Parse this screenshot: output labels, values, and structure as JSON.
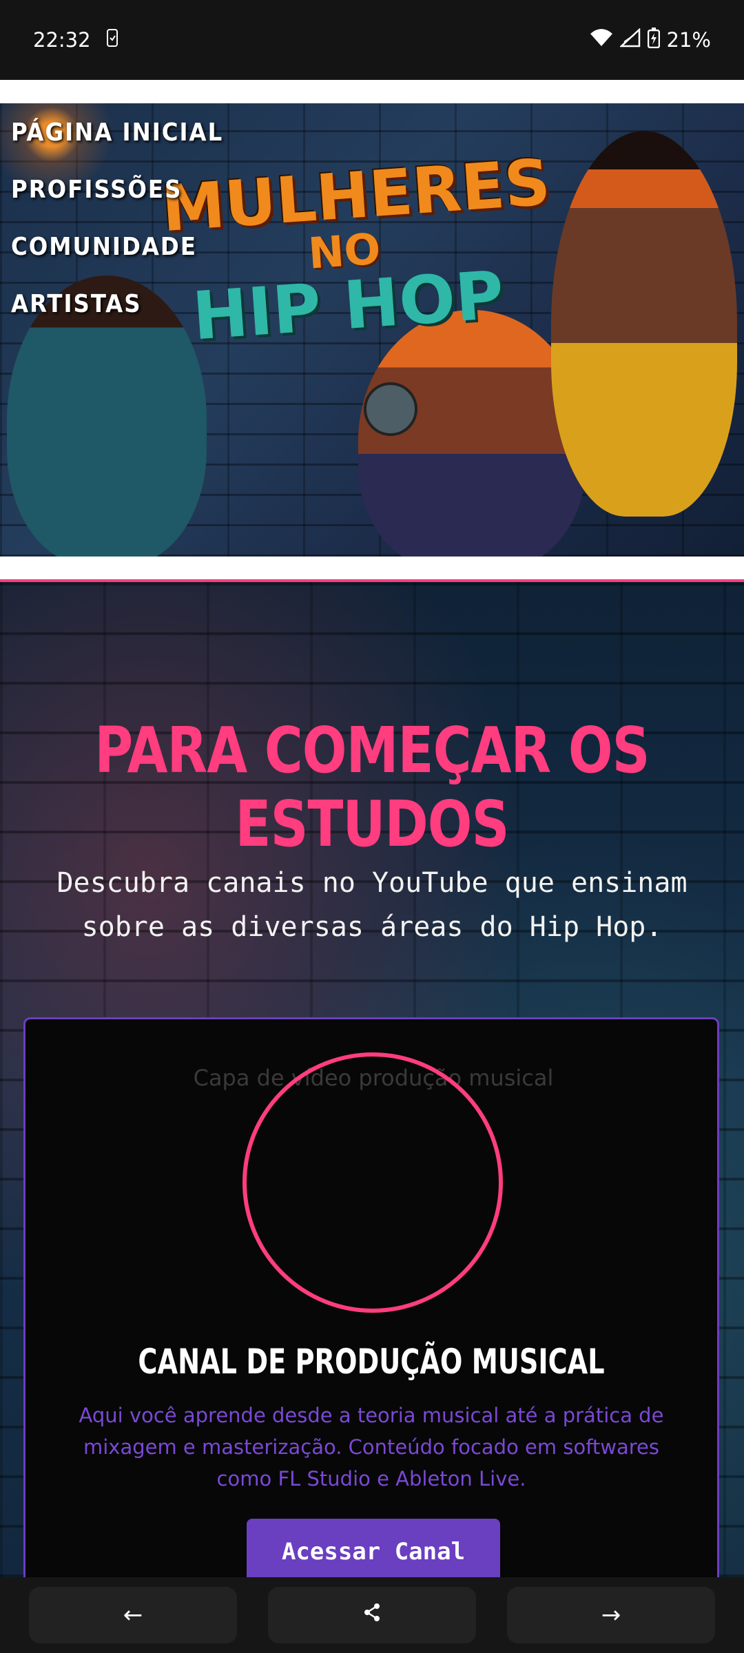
{
  "status_bar": {
    "time": "22:32",
    "battery": "21%",
    "icons": [
      "phone-notification-icon",
      "wifi-icon",
      "signal-icon",
      "battery-charging-icon"
    ]
  },
  "nav": {
    "items": [
      {
        "label": "PÁGINA INICIAL"
      },
      {
        "label": "PROFISSÕES"
      },
      {
        "label": "COMUNIDADE"
      },
      {
        "label": "ARTISTAS"
      }
    ]
  },
  "hero": {
    "title_line1": "MULHERES",
    "title_line2": "NO",
    "title_line3": "HIP HOP"
  },
  "section": {
    "title": "PARA COMEÇAR OS ESTUDOS",
    "description": "Descubra canais no YouTube que ensinam sobre as diversas áreas do Hip Hop."
  },
  "card": {
    "image_alt": "Capa de vídeo produção musical",
    "title": "CANAL DE PRODUÇÃO MUSICAL",
    "description": "Aqui você aprende desde a teoria musical até a prática de mixagem e masterização. Conteúdo focado em softwares como FL Studio e Ableton Live.",
    "button_label": "Acessar Canal"
  },
  "bottom_bar": {
    "back_icon": "←",
    "share_icon": "share-icon",
    "forward_icon": "→"
  },
  "colors": {
    "accent_pink": "#ff3d7f",
    "accent_purple": "#6a3fc0"
  }
}
